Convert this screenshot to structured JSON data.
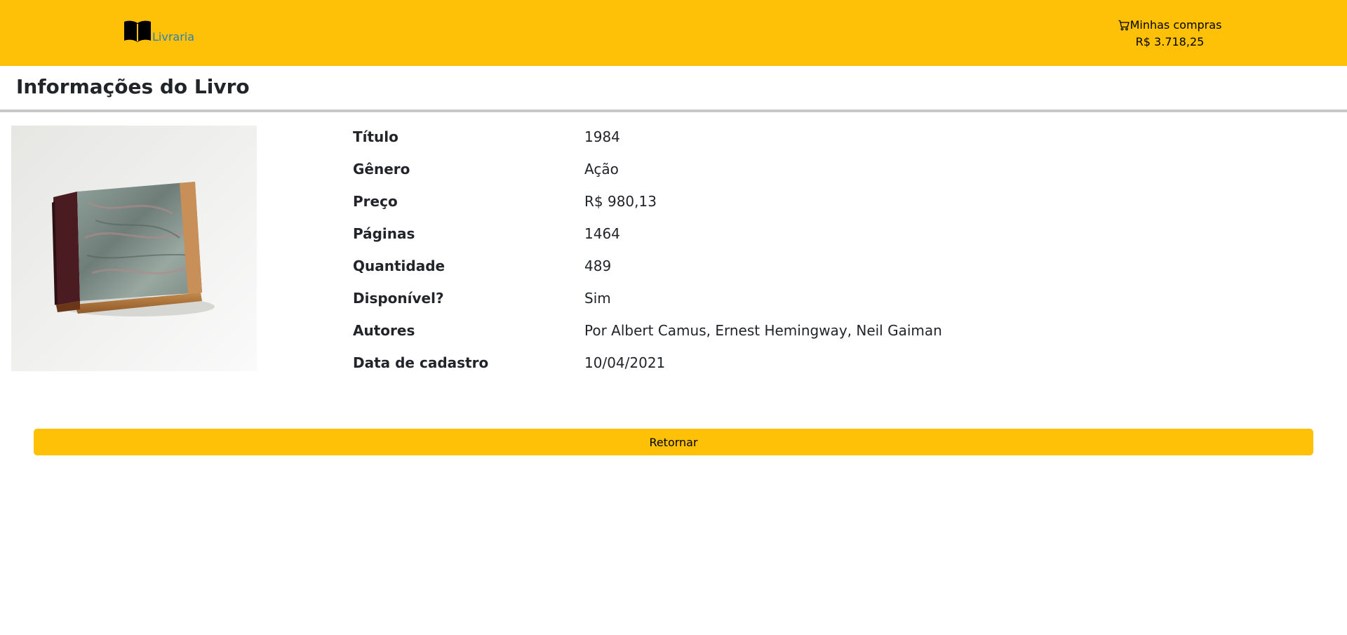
{
  "header": {
    "brand_label": "Livraria",
    "brand_icon": "open-book-icon",
    "cart_icon": "cart-icon",
    "cart_label": "Minhas compras",
    "cart_total": "R$ 3.718,25",
    "accent_color": "#ffc107"
  },
  "page": {
    "title": "Informações do Livro"
  },
  "book": {
    "rows": [
      {
        "label": "Título",
        "value": "1984"
      },
      {
        "label": "Gênero",
        "value": "Ação"
      },
      {
        "label": "Preço",
        "value": "R$ 980,13"
      },
      {
        "label": "Páginas",
        "value": "1464"
      },
      {
        "label": "Quantidade",
        "value": "489"
      },
      {
        "label": "Disponível?",
        "value": "Sim"
      },
      {
        "label": "Autores",
        "value": "Por Albert Camus, Ernest Hemingway, Neil Gaiman"
      },
      {
        "label": "Data de cadastro",
        "value": "10/04/2021"
      }
    ]
  },
  "actions": {
    "return_label": "Retornar"
  }
}
